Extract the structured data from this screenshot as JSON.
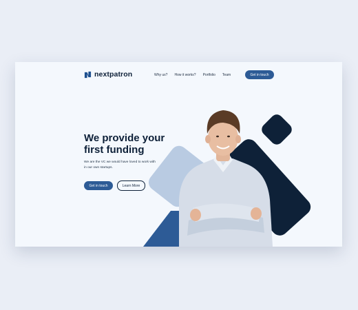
{
  "brand": {
    "name": "nextpatron",
    "logo_icon": "n-logo-icon"
  },
  "nav": {
    "items": [
      "Why us?",
      "How it works?",
      "Portfolio",
      "Team"
    ],
    "cta_label": "Get in touch"
  },
  "hero": {
    "headline": "We provide your\nfirst funding",
    "subtext": "We are the VC we would have loved to work with\nin our own startups.",
    "primary_button": "Get in touch",
    "secondary_button": "Learn More"
  },
  "colors": {
    "page_bg": "#eaeef6",
    "frame_bg": "#f4f8fd",
    "navy": "#0d2038",
    "blue": "#2d5b96",
    "light_blue": "#b9cbe2"
  }
}
